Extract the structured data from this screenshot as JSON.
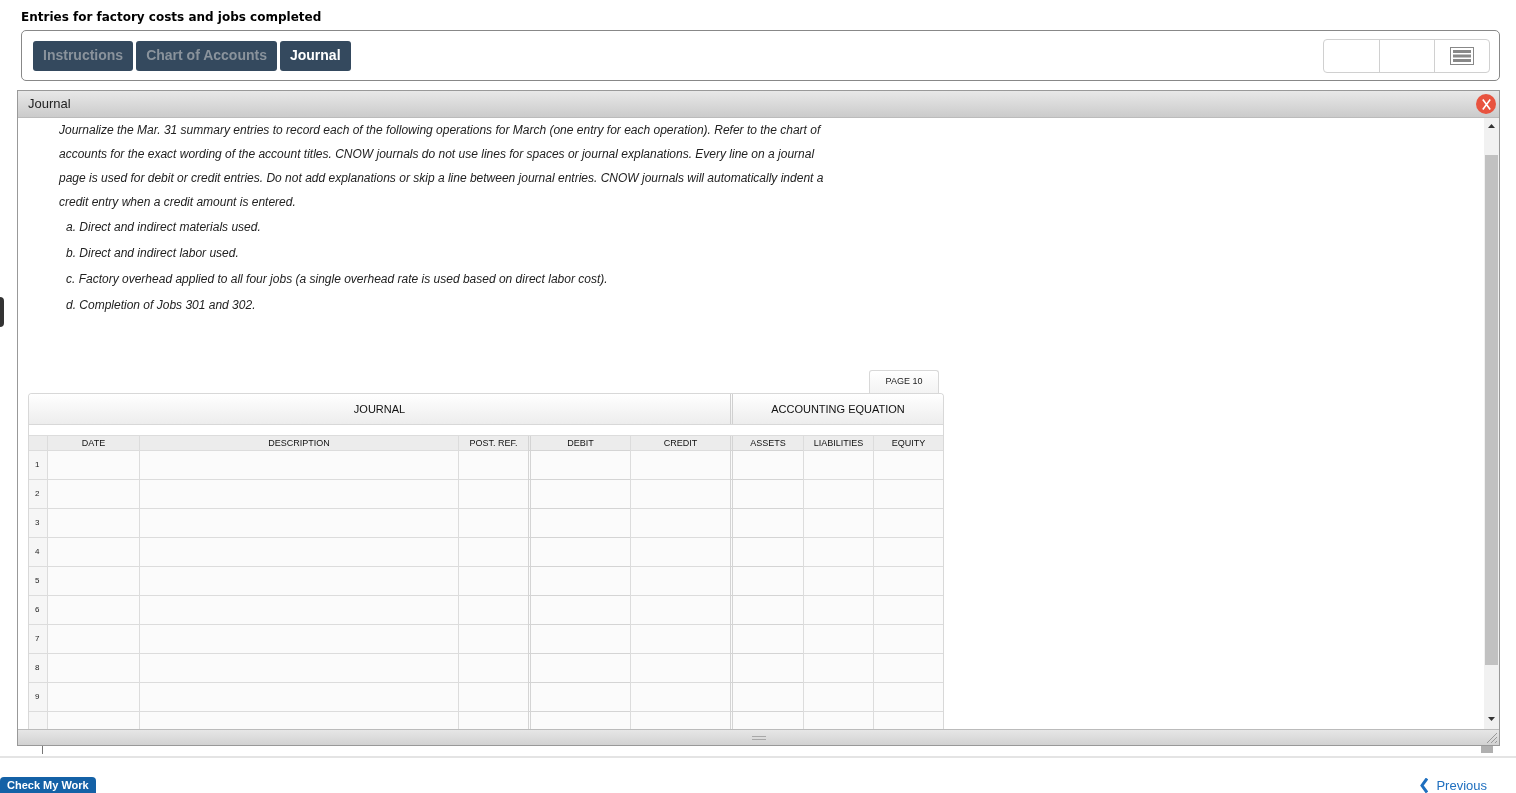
{
  "title": "Entries for factory costs and jobs completed",
  "tabs": [
    {
      "label": "Instructions",
      "selected": false
    },
    {
      "label": "Chart of Accounts",
      "selected": false
    },
    {
      "label": "Journal",
      "selected": true
    }
  ],
  "journal_window": {
    "title": "Journal",
    "instructions": "Journalize the Mar. 31 summary entries to record each of the following operations for March (one entry for each operation). Refer to the chart of accounts for the exact wording of the account titles. CNOW journals do not use lines for spaces or journal explanations. Every line on a journal page is used for debit or credit entries. Do not add explanations or skip a line between journal entries. CNOW journals will automatically indent a credit entry when a credit amount is entered.",
    "operations": [
      "a. Direct and indirect materials used.",
      "b. Direct and indirect labor used.",
      "c. Factory overhead applied to all four jobs (a single overhead rate is used based on direct labor cost).",
      "d. Completion of Jobs 301 and 302."
    ],
    "journal": {
      "page": "PAGE 10",
      "groups": [
        "JOURNAL",
        "ACCOUNTING EQUATION"
      ],
      "columns": [
        "DATE",
        "DESCRIPTION",
        "POST. REF.",
        "DEBIT",
        "CREDIT",
        "ASSETS",
        "LIABILITIES",
        "EQUITY"
      ],
      "rows": [
        "1",
        "2",
        "3",
        "4",
        "5",
        "6",
        "7",
        "8",
        "9"
      ]
    }
  },
  "footer": {
    "check_button": "Check My Work",
    "previous_link": "Previous"
  }
}
